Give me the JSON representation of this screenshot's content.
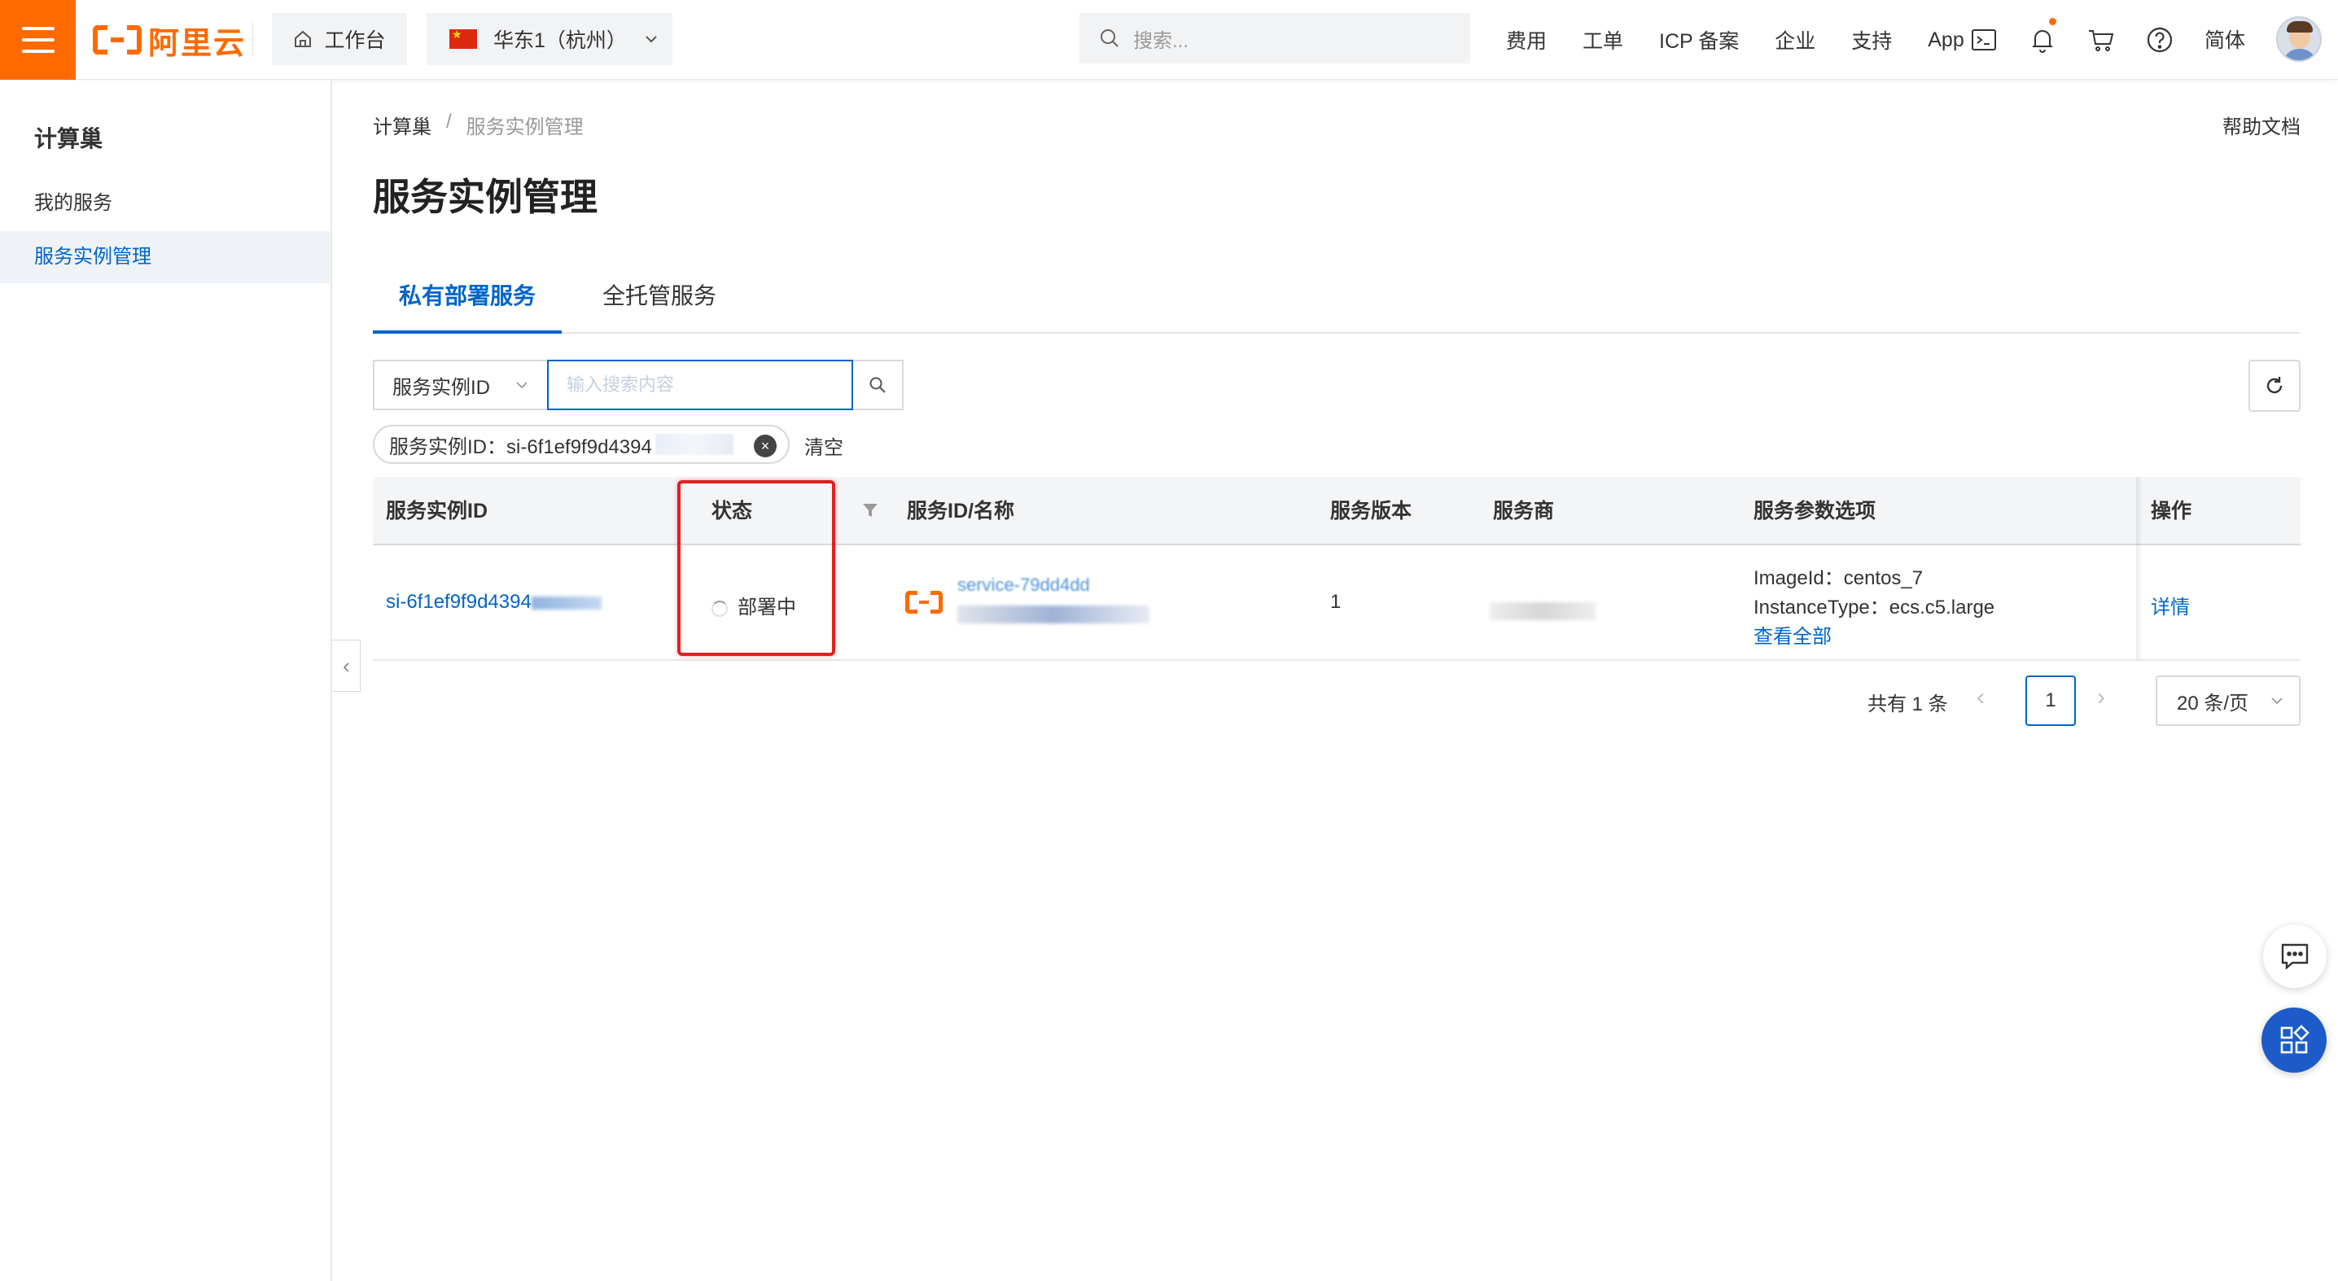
{
  "topbar": {
    "logo_text": "阿里云",
    "workbench": "工作台",
    "region": "华东1（杭州）",
    "search_placeholder": "搜索...",
    "links": [
      "费用",
      "工单",
      "ICP 备案",
      "企业",
      "支持",
      "App"
    ],
    "lang": "简体",
    "accent_color": "#ff6a00"
  },
  "sidebar": {
    "title": "计算巢",
    "items": [
      {
        "label": "我的服务"
      },
      {
        "label": "服务实例管理"
      }
    ]
  },
  "breadcrumb": {
    "root": "计算巢",
    "sep": "/",
    "current": "服务实例管理"
  },
  "help_link": "帮助文档",
  "page_title": "服务实例管理",
  "tabs": [
    {
      "label": "私有部署服务"
    },
    {
      "label": "全托管服务"
    }
  ],
  "filter": {
    "field": "服务实例ID",
    "input_placeholder": "输入搜索内容",
    "tag_label": "服务实例ID：si-6f1ef9f9d4394",
    "clear": "清空"
  },
  "table": {
    "columns": [
      "服务实例ID",
      "状态",
      "服务ID/名称",
      "服务版本",
      "服务商",
      "服务参数选项",
      "操作"
    ],
    "rows": [
      {
        "instance_id": "si-6f1ef9f9d4394",
        "status": "部署中",
        "service_id": "service-79dd4dd",
        "version": "1",
        "params": [
          "ImageId：centos_7",
          "InstanceType：ecs.c5.large"
        ],
        "view_all": "查看全部",
        "action": "详情"
      }
    ]
  },
  "pagination": {
    "total": "共有 1 条",
    "current": "1",
    "page_size": "20 条/页"
  },
  "colors": {
    "primary": "#0064c8",
    "highlight": "#e02020"
  }
}
